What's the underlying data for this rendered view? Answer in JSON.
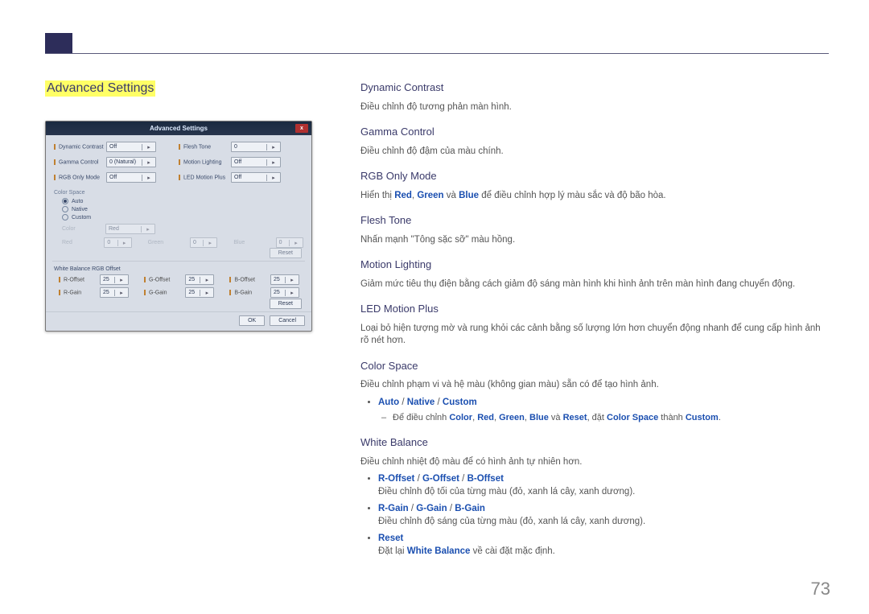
{
  "page": {
    "number": "73"
  },
  "left": {
    "title": "Advanced Settings",
    "osd": {
      "title": "Advanced Settings",
      "close": "x",
      "rows1": [
        {
          "label": "Dynamic Contrast",
          "value": "Off",
          "label2": "Flesh Tone",
          "value2": "0"
        },
        {
          "label": "Gamma Control",
          "value": "0 (Natural)",
          "label2": "Motion Lighting",
          "value2": "Off"
        },
        {
          "label": "RGB Only Mode",
          "value": "Off",
          "label2": "LED Motion Plus",
          "value2": "Off"
        }
      ],
      "color_space_title": "Color Space",
      "radios": [
        {
          "label": "Auto",
          "active": true
        },
        {
          "label": "Native",
          "active": false
        },
        {
          "label": "Custom",
          "active": false
        }
      ],
      "color_row": {
        "label": "Color",
        "value": "Red"
      },
      "rgb_row": [
        {
          "label": "Red",
          "value": "0"
        },
        {
          "label": "Green",
          "value": "0"
        },
        {
          "label": "Blue",
          "value": "0"
        }
      ],
      "reset_label": "Reset",
      "wb_title": "White Balance RGB Offset",
      "wb_rows": [
        [
          {
            "label": "R-Offset",
            "value": "25"
          },
          {
            "label": "G-Offset",
            "value": "25"
          },
          {
            "label": "B-Offset",
            "value": "25"
          }
        ],
        [
          {
            "label": "R-Gain",
            "value": "25"
          },
          {
            "label": "G-Gain",
            "value": "25"
          },
          {
            "label": "B-Gain",
            "value": "25"
          }
        ]
      ],
      "ok_label": "OK",
      "cancel_label": "Cancel"
    }
  },
  "right": {
    "sections": [
      {
        "h": "Dynamic Contrast",
        "p": "Điều chỉnh độ tương phản màn hình."
      },
      {
        "h": "Gamma Control",
        "p": "Điều chỉnh độ đậm của màu chính."
      },
      {
        "h": "RGB Only Mode",
        "p_pre": "Hiển thị ",
        "p_rgb": [
          "Red",
          "Green",
          "Blue"
        ],
        "p_joins": [
          ", ",
          " và "
        ],
        "p_post": " để điều chỉnh hợp lý màu sắc và độ bão hòa."
      },
      {
        "h": "Flesh Tone",
        "p": "Nhấn mạnh \"Tông sặc sỡ\" màu hồng."
      },
      {
        "h": "Motion Lighting",
        "p": "Giảm mức tiêu thụ điện bằng cách giảm độ sáng màn hình khi hình ảnh trên màn hình đang chuyển động."
      },
      {
        "h": "LED Motion Plus",
        "p": "Loại bỏ hiện tượng mờ và rung khỏi các cảnh bằng số lượng lớn hơn chuyển động nhanh để cung cấp hình ảnh rõ nét hơn."
      },
      {
        "h": "Color Space",
        "p": "Điều chỉnh phạm vi và hệ màu (không gian màu) sẵn có để tạo hình ảnh.",
        "bullet1_terms": [
          "Auto",
          "Native",
          "Custom"
        ],
        "sub_pre": "Để điều chỉnh ",
        "sub_terms": [
          "Color",
          "Red",
          "Green",
          "Blue"
        ],
        "sub_and": " và ",
        "sub_reset": "Reset",
        "sub_mid": ", đặt ",
        "sub_cs": "Color Space",
        "sub_to": " thành ",
        "sub_custom": "Custom",
        "sub_period": "."
      },
      {
        "h": "White Balance",
        "p": "Điều chỉnh nhiệt độ màu để có hình ảnh tự nhiên hơn.",
        "bullets": [
          {
            "terms": [
              "R-Offset",
              "G-Offset",
              "B-Offset"
            ],
            "desc": "Điều chỉnh độ tối của từng màu (đỏ, xanh lá cây, xanh dương)."
          },
          {
            "terms": [
              "R-Gain",
              "G-Gain",
              "B-Gain"
            ],
            "desc": "Điều chỉnh độ sáng của từng màu (đỏ, xanh lá cây, xanh dương)."
          },
          {
            "terms": [
              "Reset"
            ],
            "desc_pre": "Đặt lại ",
            "desc_term": "White Balance",
            "desc_post": " về cài đặt mặc định."
          }
        ]
      }
    ]
  }
}
